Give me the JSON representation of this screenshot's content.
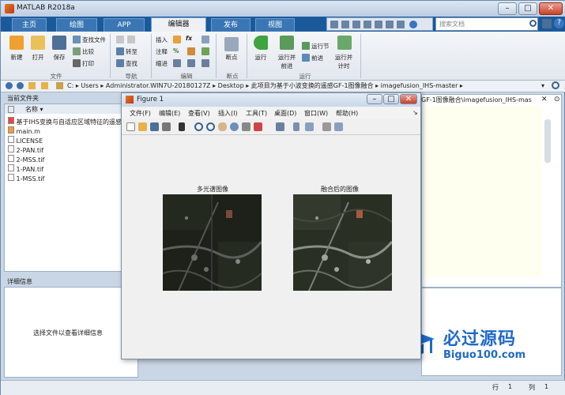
{
  "window": {
    "title": "MATLAB R2018a"
  },
  "tabs": [
    "主页",
    "绘图",
    "APP",
    "编辑器",
    "发布",
    "视图"
  ],
  "active_tab": "编辑器",
  "search": {
    "placeholder": "搜索文档"
  },
  "help_glyph": "?",
  "ribbon": {
    "file": {
      "new": "新建",
      "open": "打开",
      "save": "保存",
      "find_files": "查找文件",
      "compare": "比较",
      "print": "打印",
      "group": "文件"
    },
    "nav": {
      "goto": "转至",
      "find": "查找",
      "group": "导航"
    },
    "edit": {
      "insert": "插入",
      "comment": "注释",
      "indent": "缩进",
      "fx": "fx",
      "pct": "%",
      "group": "编辑"
    },
    "breakpoints": {
      "label": "断点",
      "group": "断点"
    },
    "run": {
      "run": "运行",
      "run_advance": "运行并\n前进",
      "run_section": "运行节",
      "advance": "前进",
      "run_time": "运行并\n计时",
      "group": "运行"
    }
  },
  "address": {
    "segments": [
      "C:",
      "Users",
      "Administrator.WIN7U-20180127Z",
      "Desktop",
      "此项目为基于小波变换的遥感GF-1图像融合",
      "imagefusion_IHS-master"
    ]
  },
  "current_folder": {
    "title": "当前文件夹",
    "column": "名称",
    "files": [
      "基于IHS变换与自适应区域特征的遥感图像融合算法.pdf",
      "main.m",
      "LICENSE",
      "2-PAN.tif",
      "2-MSS.tif",
      "1-PAN.tif",
      "1-MSS.tif"
    ]
  },
  "details": {
    "title": "详细信息",
    "hint": "选择文件以查看详细信息"
  },
  "right_panel_path": "GF-1图像融合\\imagefusion_IHS-mast...",
  "status": {
    "row_label": "行",
    "row": "1",
    "col_label": "列",
    "col": "1"
  },
  "figure": {
    "title": "Figure 1",
    "menu": [
      "文件(F)",
      "编辑(E)",
      "查看(V)",
      "插入(I)",
      "工具(T)",
      "桌面(D)",
      "窗口(W)",
      "帮助(H)"
    ],
    "images": [
      {
        "title": "多光谱图像"
      },
      {
        "title": "融合后的图像"
      }
    ]
  },
  "watermark": {
    "text": "必过源码",
    "url": "Biguo100.com"
  },
  "colors": {
    "tab_bar": "#1a5a9b",
    "accent": "#1f69c9"
  }
}
